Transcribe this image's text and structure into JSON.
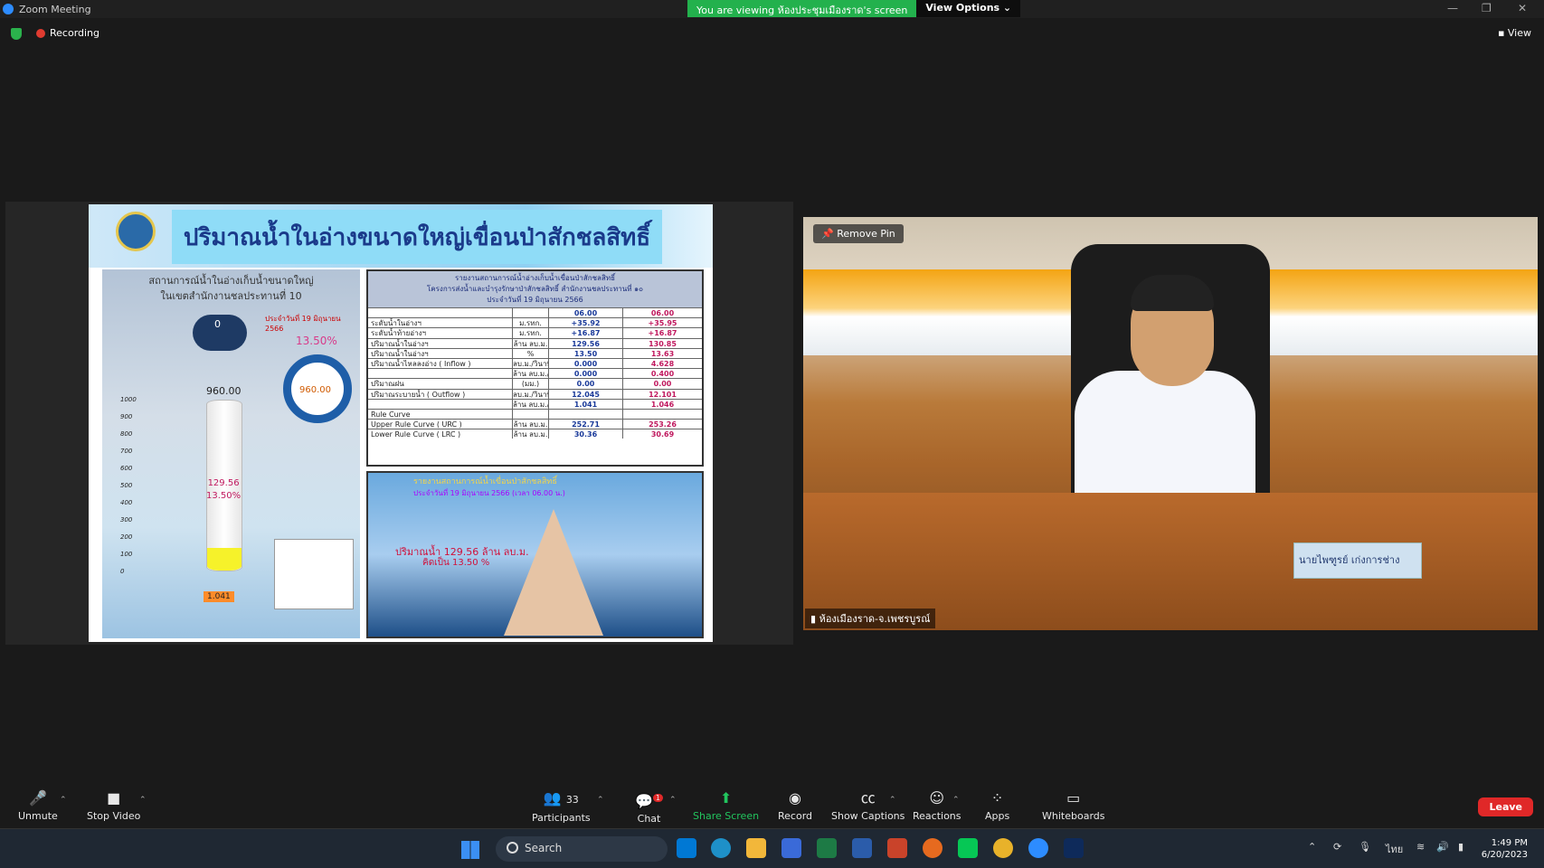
{
  "window": {
    "title": "Zoom Meeting"
  },
  "banner": {
    "viewing": "You are viewing ห้องประชุมเมืองราด's screen",
    "view_options": "View Options"
  },
  "status": {
    "recording": "Recording",
    "view": "View"
  },
  "slide": {
    "title": "ปริมาณน้ำในอ่างขนาดใหญ่เขื่อนป่าสักชลสิทธิ์",
    "left_title_1": "สถานการณ์น้ำในอ่างเก็บน้ำขนาดใหญ่",
    "left_title_2": "ในเขตสำนักงานชลประทานที่ 10",
    "left_date": "ประจำวันที่ 19 มิถุนายน 2566",
    "inflow_value": "0",
    "percent": "13.50%",
    "capacity": "960.00",
    "gauge_capacity": "960.00",
    "volume": "129.56",
    "volume_pct": "13.50%",
    "release": "1.041",
    "y_ticks": [
      "1000",
      "900",
      "800",
      "700",
      "600",
      "500",
      "400",
      "300",
      "200",
      "100",
      "0"
    ],
    "fill_ratio": 0.135
  },
  "table": {
    "header_1": "รายงานสถานการณ์น้ำอ่างเก็บน้ำเขื่อนป่าสักชลสิทธิ์",
    "header_2": "โครงการส่งน้ำและบำรุงรักษาป่าสักชลสิทธิ์ สำนักงานชลประทานที่ ๑๐",
    "header_3": "ประจำวันที่ 19 มิถุนายน 2566",
    "col_time_a": "06.00",
    "col_time_b": "06.00",
    "rows": [
      {
        "label": "ระดับน้ำในอ่างฯ",
        "unit": "ม.รทก.",
        "a": "+35.92",
        "b": "+35.95"
      },
      {
        "label": "ระดับน้ำท้ายอ่างฯ",
        "unit": "ม.รทก.",
        "a": "+16.87",
        "b": "+16.87"
      },
      {
        "label": "ปริมาณน้ำในอ่างฯ",
        "unit": "ล้าน ลบ.ม.",
        "a": "129.56",
        "b": "130.85"
      },
      {
        "label": "ปริมาณน้ำในอ่างฯ",
        "unit": "%",
        "a": "13.50",
        "b": "13.63"
      },
      {
        "label": "ปริมาณน้ำไหลลงอ่าง ( Inflow )",
        "unit": "ลบ.ม./วินาที",
        "a": "0.000",
        "b": "4.628"
      },
      {
        "label": "",
        "unit": "ล้าน ลบ.ม./วัน",
        "a": "0.000",
        "b": "0.400"
      },
      {
        "label": "ปริมาณฝน",
        "unit": "(มม.)",
        "a": "0.00",
        "b": "0.00"
      },
      {
        "label": "ปริมาณระบายน้ำ ( Outflow )",
        "unit": "ลบ.ม./วินาที",
        "a": "12.045",
        "b": "12.101"
      },
      {
        "label": "",
        "unit": "ล้าน ลบ.ม./วัน",
        "a": "1.041",
        "b": "1.046"
      },
      {
        "label": "Rule Curve",
        "unit": "",
        "a": "",
        "b": ""
      },
      {
        "label": "Upper Rule Curve ( URC )",
        "unit": "ล้าน ลบ.ม.",
        "a": "252.71",
        "b": "253.26"
      },
      {
        "label": "Lower Rule Curve ( LRC )",
        "unit": "ล้าน ลบ.ม.",
        "a": "30.36",
        "b": "30.69"
      }
    ]
  },
  "dam": {
    "title": "รายงานสถานการณ์น้ำเขื่อนป่าสักชลสิทธิ์",
    "date": "ประจำวันที่ 19 มิถุนายน 2566 (เวลา 06.00 น.)",
    "volume": "ปริมาณน้ำ 129.56 ล้าน ลบ.ม.",
    "percent": "คิดเป็น 13.50 %"
  },
  "video": {
    "remove_pin": "Remove Pin",
    "participant": "ห้องเมืองราด-จ.เพชรบูรณ์",
    "nameplate": "นายไพฑูรย์ เก่งการช่าง"
  },
  "toolbar": {
    "unmute": "Unmute",
    "stop_video": "Stop Video",
    "participants": "Participants",
    "participant_count": "33",
    "chat": "Chat",
    "chat_badge": "1",
    "share_screen": "Share Screen",
    "record": "Record",
    "show_captions": "Show Captions",
    "reactions": "Reactions",
    "apps": "Apps",
    "whiteboards": "Whiteboards",
    "leave": "Leave"
  },
  "taskbar": {
    "search": "Search",
    "lang": "ไทย",
    "time": "1:49 PM",
    "date": "6/20/2023"
  },
  "colors": {
    "accent_green": "#23b14d",
    "leave_red": "#e02828",
    "share_green": "#22c55e"
  }
}
